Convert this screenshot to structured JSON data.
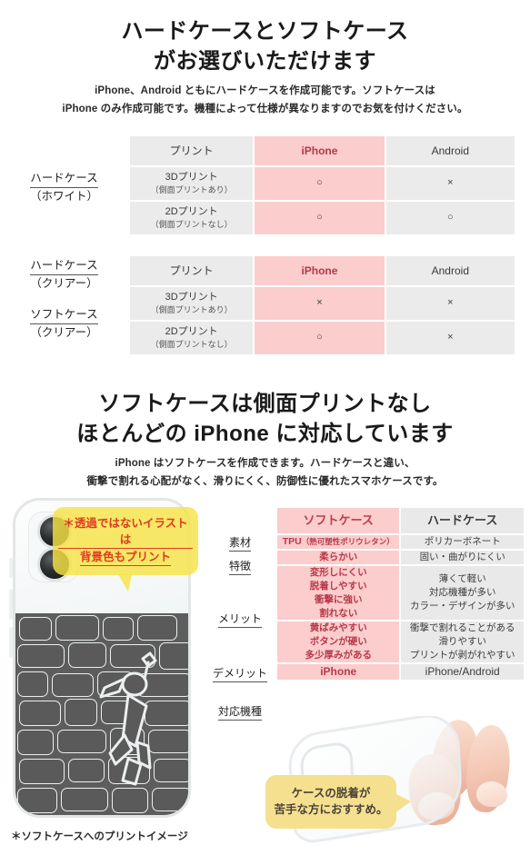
{
  "section1": {
    "title_line1": "ハードケースとソフトケース",
    "title_line2": "がお選びいただけます",
    "lead_line1": "iPhone、Android ともにハードケースを作成可能です。ソフトケースは",
    "lead_line2": "iPhone のみ作成可能です。機種によって仕様が異なりますのでお気を付けください。",
    "table1": {
      "row_label_line1": "ハードケース",
      "row_label_line2": "（ホワイト）",
      "headers": [
        "プリント",
        "iPhone",
        "Android"
      ],
      "rows": [
        {
          "print": "3Dプリント",
          "print_sub": "（側面プリントあり）",
          "iphone": "○",
          "android": "×"
        },
        {
          "print": "2Dプリント",
          "print_sub": "（側面プリントなし）",
          "iphone": "○",
          "android": "○"
        }
      ]
    },
    "table2": {
      "row_label_a_line1": "ハードケース",
      "row_label_a_line2": "（クリアー）",
      "row_label_b_line1": "ソフトケース",
      "row_label_b_line2": "（クリアー）",
      "headers": [
        "プリント",
        "iPhone",
        "Android"
      ],
      "rows": [
        {
          "print": "3Dプリント",
          "print_sub": "（側面プリントあり）",
          "iphone": "×",
          "android": "×"
        },
        {
          "print": "2Dプリント",
          "print_sub": "（側面プリントなし）",
          "iphone": "○",
          "android": "×"
        }
      ]
    }
  },
  "section2": {
    "title_line1": "ソフトケースは側面プリントなし",
    "title_line2": "ほとんどの iPhone に対応しています",
    "lead_line1": "iPhone はソフトケースを作成できます。ハードケースと違い、",
    "lead_line2": "衝撃で割れる心配がなく、滑りにくく、防御性に優れたスマホケースです。",
    "callout_print_line1": "＊透過ではないイラストは",
    "callout_print_line2": "背景色もプリント",
    "callout_tip_line1": "ケースの脱着が",
    "callout_tip_line2": "苦手な方におすすめ。",
    "footnote": "＊ソフトケースへのプリントイメージ",
    "comparison": {
      "headers": [
        "ソフトケース",
        "ハードケース"
      ],
      "row_labels": [
        "素材",
        "特徴",
        "メリット",
        "デメリット",
        "対応機種"
      ],
      "rows": [
        {
          "label": "素材",
          "soft": "TPU（熱可塑性ポリウレタン）",
          "soft_main": "TPU",
          "soft_paren": "（熱可塑性ポリウレタン）",
          "hard": "ポリカーボネート"
        },
        {
          "label": "特徴",
          "soft": "柔らかい",
          "hard": "固い・曲がりにくい"
        },
        {
          "label": "メリット",
          "soft": "変形しにくい\n脱着しやすい\n衝撃に強い\n割れない",
          "hard": "薄くて軽い\n対応機種が多い\nカラー・デザインが多い"
        },
        {
          "label": "デメリット",
          "soft": "黄ばみやすい\nボタンが硬い\n多少厚みがある",
          "hard": "衝撃で割れることがある\n滑りやすい\nプリントが剥がれやすい"
        },
        {
          "label": "対応機種",
          "soft": "iPhone",
          "hard": "iPhone/Android"
        }
      ]
    }
  },
  "colors": {
    "pink": "#fbcdcd",
    "gray": "#ebebeb",
    "red_text": "#b23a48",
    "yellow": "#f6e36a",
    "yellow_tip": "#f4e08f",
    "callout_red": "#e03a1e"
  }
}
